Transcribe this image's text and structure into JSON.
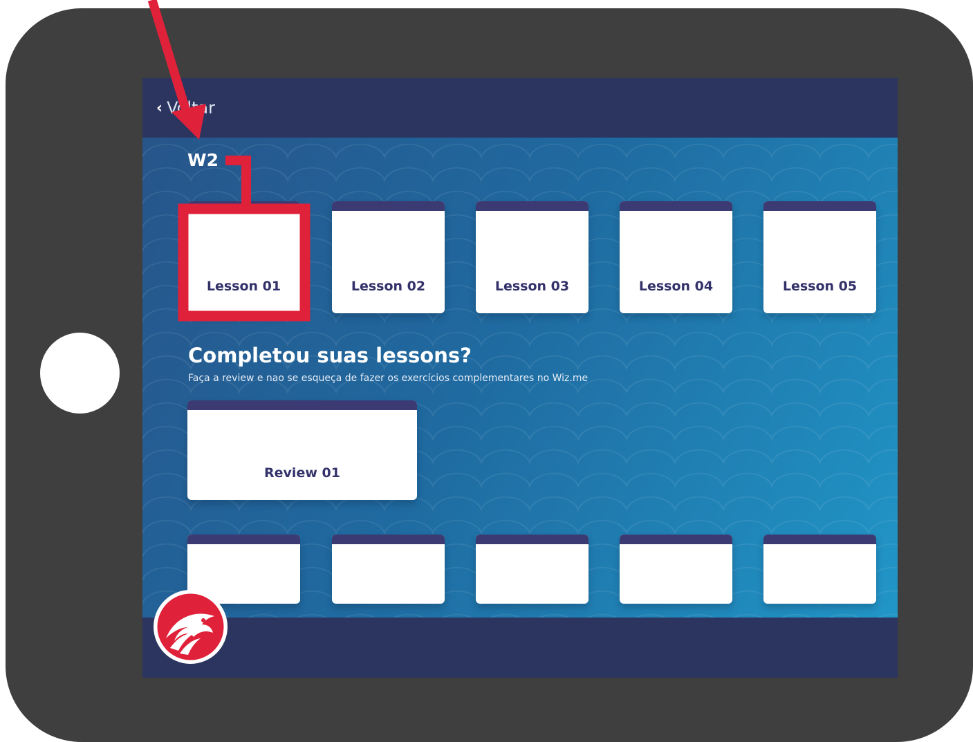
{
  "header": {
    "back_label": "Voltar"
  },
  "week": {
    "title": "W2"
  },
  "lessons": [
    {
      "label": "Lesson 01"
    },
    {
      "label": "Lesson 02"
    },
    {
      "label": "Lesson 03"
    },
    {
      "label": "Lesson 04"
    },
    {
      "label": "Lesson 05"
    }
  ],
  "review_section": {
    "heading": "Completou suas lessons?",
    "subtitle": "Faça a review e nao se esqueça de fazer os exercícios complementares no Wiz.me",
    "cards": [
      {
        "label": "Review 01"
      }
    ]
  },
  "colors": {
    "device": "#3f3f3f",
    "bar": "#2b3560",
    "card_header": "#3c3a73",
    "card_text": "#33316a",
    "annotation_red": "#e0213a"
  },
  "icons": {
    "back": "chevron-left-icon",
    "logo": "eagle-logo-icon",
    "annotation": "red-arrow-icon"
  }
}
